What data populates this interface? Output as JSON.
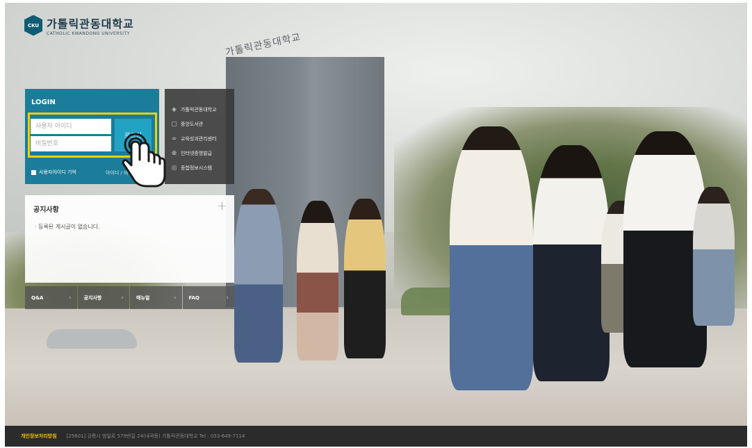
{
  "header": {
    "logo_mark": "CKU",
    "name_ko": "가톨릭관동대학교",
    "name_en": "CATHOLIC KWANDONG UNIVERSITY"
  },
  "building_sign": "가톨릭관동대학교",
  "login": {
    "title": "LOGIN",
    "id_placeholder": "사용자 아이디",
    "pw_placeholder": "비밀번호",
    "button": "로그인",
    "remember": "사용자아이디 기억",
    "find": "아이디 / 비밀번호 찾기"
  },
  "quick_links": [
    {
      "label": "가톨릭관동대학교",
      "icon": "layers-icon"
    },
    {
      "label": "중앙도서관",
      "icon": "book-icon"
    },
    {
      "label": "교육성과관리센터",
      "icon": "link-icon"
    },
    {
      "label": "인터넷증명발급",
      "icon": "crosshair-icon"
    },
    {
      "label": "종합정보시스템",
      "icon": "globe-icon"
    }
  ],
  "notice": {
    "title": "공지사항",
    "plus": "+",
    "empty": "· 등록된 게시글이 없습니다."
  },
  "menus": [
    "Q&A",
    "공지사항",
    "매뉴얼",
    "FAQ"
  ],
  "menu_arrow": "›",
  "footer": {
    "privacy": "개인정보처리방침",
    "address": "[25601] 강릉시 범일로 579번길 24(내곡동) 가톨릭관동대학교   Tel : 033-649-7114"
  },
  "colors": {
    "login_bg": "#1b7d99",
    "login_button": "#23a3c4",
    "highlight": "#f6d000",
    "footer_bg": "#2b2b2b",
    "privacy_text": "#f2c500"
  }
}
